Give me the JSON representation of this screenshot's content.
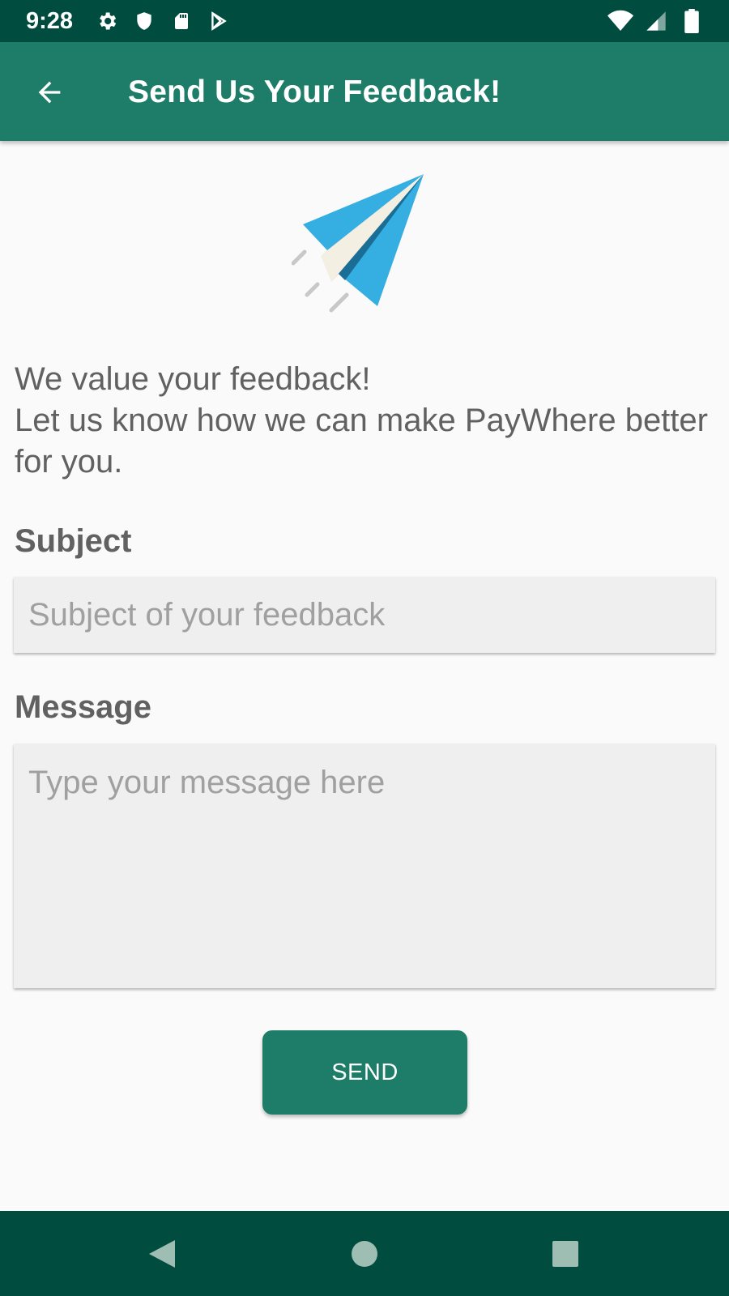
{
  "status_bar": {
    "time": "9:28",
    "left_icons": [
      "settings-icon",
      "shield-icon",
      "sd-card-icon",
      "play-store-icon"
    ],
    "right_icons": [
      "wifi-icon",
      "signal-icon",
      "battery-icon"
    ]
  },
  "app_bar": {
    "back_icon": "arrow-back-icon",
    "title": "Send Us Your Feedback!"
  },
  "hero": {
    "icon": "paper-plane-icon"
  },
  "intro": {
    "line1": "We value your feedback!",
    "line2": "Let us know how we can make PayWhere better for you."
  },
  "subject": {
    "label": "Subject",
    "value": "",
    "placeholder": "Subject of your feedback"
  },
  "message": {
    "label": "Message",
    "value": "",
    "placeholder": "Type your message here"
  },
  "send_button": {
    "label": "SEND"
  },
  "nav_bar": {
    "icons": [
      "nav-back-icon",
      "nav-home-icon",
      "nav-recent-icon"
    ]
  },
  "colors": {
    "status_bar": "#004d40",
    "app_bar": "#1e7d68",
    "button": "#1e7d68",
    "background": "#fafafa",
    "input_bg": "#efefef",
    "plane_blue": "#35aee2"
  }
}
